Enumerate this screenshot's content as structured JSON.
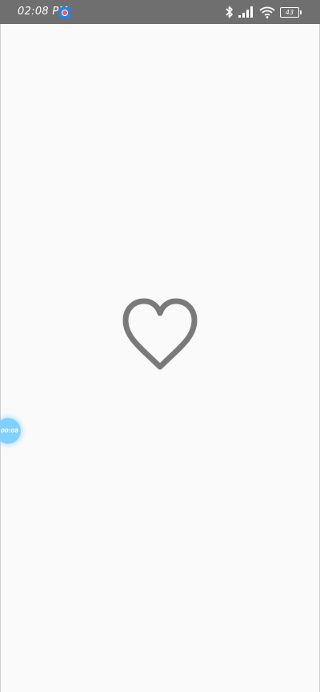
{
  "status_bar": {
    "time": "02:08 PM",
    "battery_level": "43",
    "icons": [
      "screen-recorder-icon",
      "bluetooth-icon",
      "signal-icon",
      "wifi-icon",
      "battery-icon"
    ],
    "background": "#6f6f6f"
  },
  "main": {
    "like_icon": "heart-outline-icon",
    "heart_color": "#7a7a7a",
    "background": "#fafafa"
  },
  "floating_timer": {
    "label": "00:08",
    "color": "#7fd0ff"
  }
}
